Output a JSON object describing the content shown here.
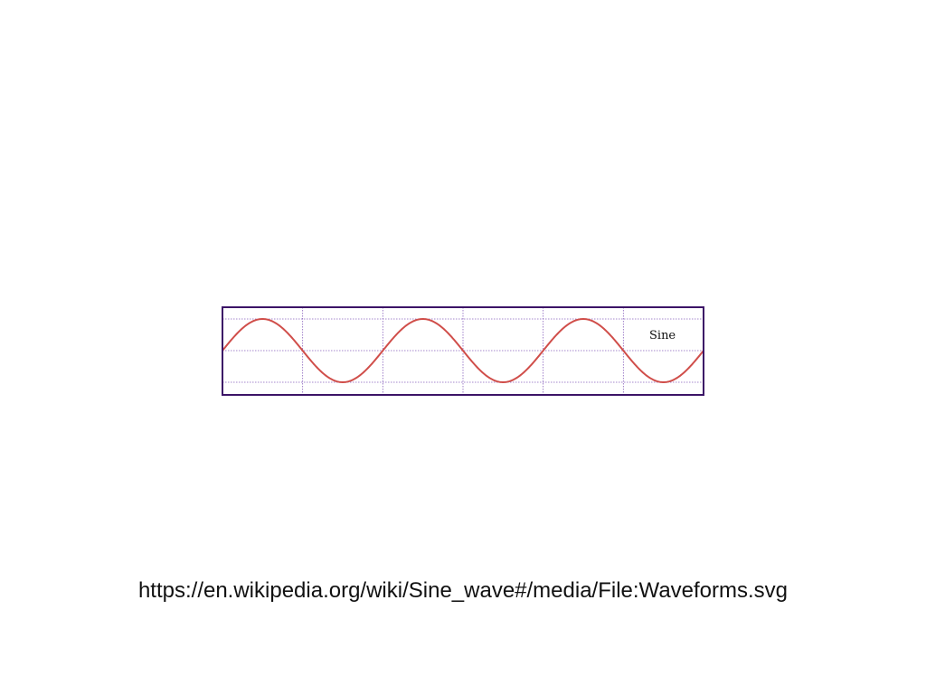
{
  "chart_data": {
    "type": "line",
    "label": "Sine",
    "function": "sin",
    "cycles": 3,
    "ylim": [
      -1,
      1
    ],
    "grid": true,
    "colors": {
      "wave": "#d04e4a",
      "frame": "#3c1467",
      "grid": "#7b4fb5"
    }
  },
  "caption": {
    "text": "https://en.wikipedia.org/wiki/Sine_wave#/media/File:Waveforms.svg"
  }
}
